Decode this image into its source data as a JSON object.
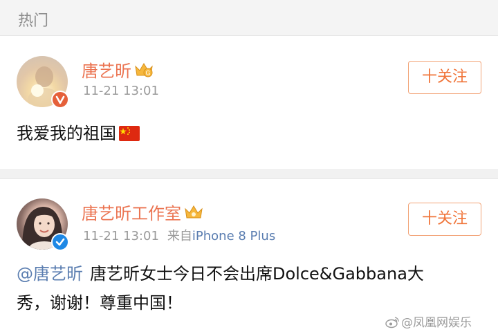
{
  "header": {
    "title": "热门"
  },
  "posts": [
    {
      "username": "唐艺昕",
      "crown_badge": "G",
      "timestamp": "11-21 13:01",
      "source_prefix": "",
      "source_device": "",
      "follow_label": "十关注",
      "verified_color": "#e5603a",
      "content_mention": "",
      "content_text": "我爱我的祖国"
    },
    {
      "username": "唐艺昕工作室",
      "timestamp": "11-21 13:01",
      "source_prefix": "来自",
      "source_device": "iPhone 8 Plus",
      "follow_label": "十关注",
      "verified_color": "#1e88e5",
      "content_mention": "@唐艺昕",
      "content_line1": "唐艺昕女士今日不会出席Dolce&Gabbana大",
      "content_line2": "秀，谢谢！尊重中国！"
    }
  ],
  "watermark": {
    "text": "@凤凰网娱乐",
    "icon": "weibo-icon"
  },
  "colors": {
    "accent": "#eb7350",
    "link": "#5a7db0",
    "meta": "#9a9a9a"
  }
}
